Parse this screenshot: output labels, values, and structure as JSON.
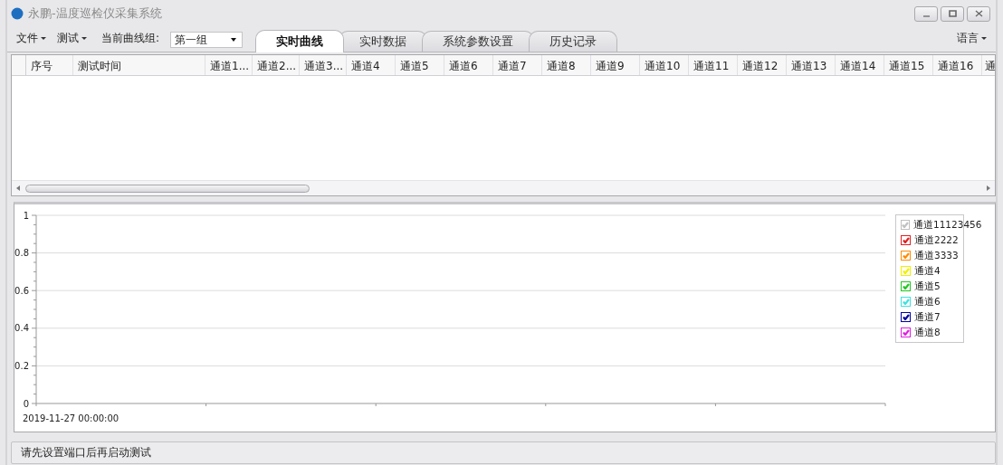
{
  "window": {
    "title": "永鹏-温度巡检仪采集系统"
  },
  "menu": [
    {
      "label": "文件"
    },
    {
      "label": "测试"
    }
  ],
  "curve_group": {
    "label": "当前曲线组:",
    "value": "第一组"
  },
  "tabs": [
    {
      "label": "实时曲线",
      "selected": true
    },
    {
      "label": "实时数据",
      "selected": false
    },
    {
      "label": "系统参数设置",
      "selected": false
    },
    {
      "label": "历史记录",
      "selected": false
    }
  ],
  "language_menu": {
    "label": "语言"
  },
  "table": {
    "columns": [
      "序号",
      "测试时间",
      "通道1...",
      "通道2...",
      "通道3...",
      "通道4",
      "通道5",
      "通道6",
      "通道7",
      "通道8",
      "通道9",
      "通道10",
      "通道11",
      "通道12",
      "通道13",
      "通道14",
      "通道15",
      "通道16",
      "通"
    ]
  },
  "chart": {
    "chart_data": {
      "type": "line",
      "grid": true,
      "categories": [
        null,
        null,
        null,
        null,
        null,
        null
      ],
      "ylim": [
        0,
        1
      ],
      "yticks": [
        {
          "value": 0,
          "label": "0"
        },
        {
          "value": 0.2,
          "label": "0.2"
        },
        {
          "value": 0.4,
          "label": "0.4"
        },
        {
          "value": 0.6,
          "label": "0.6"
        },
        {
          "value": 0.8,
          "label": "0.8"
        },
        {
          "value": 1,
          "label": "1"
        }
      ],
      "series": [
        {
          "name": "通道11123456",
          "color": "#c0c0c0",
          "values": [
            null,
            null,
            null,
            null,
            null,
            null
          ]
        },
        {
          "name": "通道2222",
          "color": "#e02020",
          "values": [
            null,
            null,
            null,
            null,
            null,
            null
          ]
        },
        {
          "name": "通道3333",
          "color": "#ff8c00",
          "values": [
            null,
            null,
            null,
            null,
            null,
            null
          ]
        },
        {
          "name": "通道4",
          "color": "#f0f000",
          "values": [
            null,
            null,
            null,
            null,
            null,
            null
          ]
        },
        {
          "name": "通道5",
          "color": "#22c822",
          "values": [
            null,
            null,
            null,
            null,
            null,
            null
          ]
        },
        {
          "name": "通道6",
          "color": "#40e0e0",
          "values": [
            null,
            null,
            null,
            null,
            null,
            null
          ]
        },
        {
          "name": "通道7",
          "color": "#0000a0",
          "values": [
            null,
            null,
            null,
            null,
            null,
            null
          ]
        },
        {
          "name": "通道8",
          "color": "#e020e0",
          "values": [
            null,
            null,
            null,
            null,
            null,
            null
          ]
        }
      ]
    },
    "legend": [
      {
        "checked": true
      },
      {
        "checked": true
      },
      {
        "checked": true
      },
      {
        "checked": true
      },
      {
        "checked": true
      },
      {
        "checked": true
      },
      {
        "checked": true
      },
      {
        "checked": true
      }
    ],
    "start_time": "2019-11-27 00:00:00"
  },
  "status_bar": {
    "text": "请先设置端口后再启动测试"
  }
}
